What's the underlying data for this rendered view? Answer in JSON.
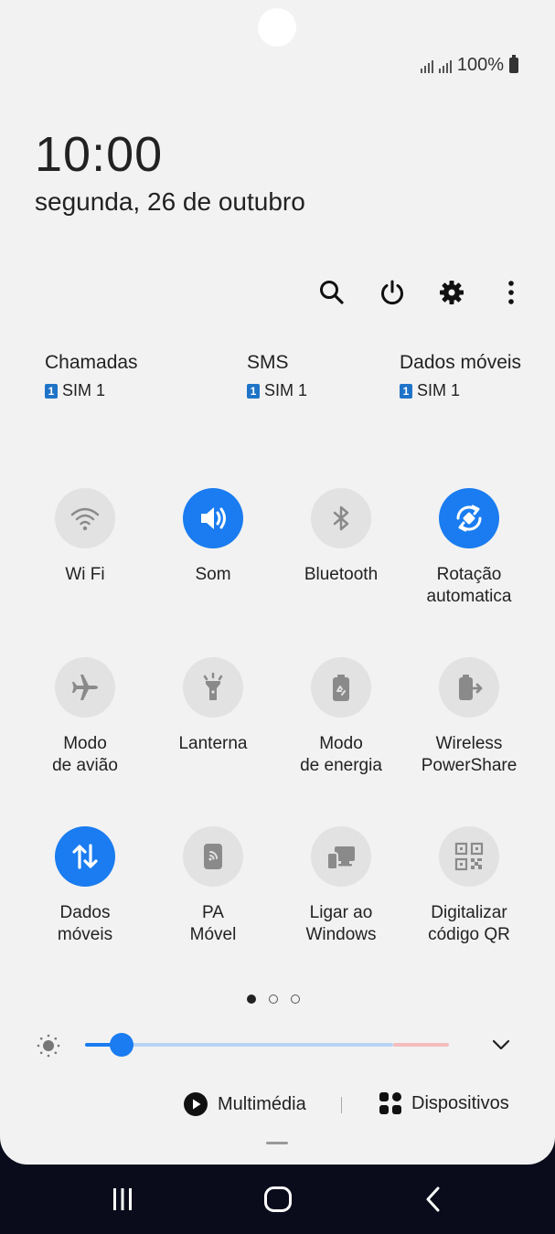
{
  "status_bar": {
    "battery_text": "100%"
  },
  "clock": {
    "time": "10:00",
    "date": "segunda, 26 de outubro"
  },
  "toolbar": {
    "icons": [
      "search-icon",
      "power-icon",
      "gear-icon",
      "more-vert-icon"
    ]
  },
  "sim_settings": [
    {
      "title": "Chamadas",
      "badge": "1",
      "sim": "SIM 1"
    },
    {
      "title": "SMS",
      "badge": "1",
      "sim": "SIM 1"
    },
    {
      "title": "Dados móveis",
      "badge": "1",
      "sim": "SIM 1"
    }
  ],
  "tiles": [
    {
      "label": "Wi Fi",
      "icon": "wifi-icon",
      "active": false
    },
    {
      "label": "Som",
      "icon": "volume-icon",
      "active": true
    },
    {
      "label": "Bluetooth",
      "icon": "bluetooth-icon",
      "active": false
    },
    {
      "label": "Rotação\nautomatica",
      "icon": "rotate-icon",
      "active": true
    },
    {
      "label": "Modo\nde avião",
      "icon": "airplane-icon",
      "active": false
    },
    {
      "label": "Lanterna",
      "icon": "flashlight-icon",
      "active": false
    },
    {
      "label": "Modo\nde energia",
      "icon": "battery-saver-icon",
      "active": false
    },
    {
      "label": "Wireless\nPowerShare",
      "icon": "powershare-icon",
      "active": false
    },
    {
      "label": "Dados\nmóveis",
      "icon": "data-arrows-icon",
      "active": true
    },
    {
      "label": "PA\nMóvel",
      "icon": "hotspot-icon",
      "active": false
    },
    {
      "label": "Ligar ao\nWindows",
      "icon": "link-windows-icon",
      "active": false
    },
    {
      "label": "Digitalizar\ncódigo QR",
      "icon": "qr-code-icon",
      "active": false
    }
  ],
  "pager": {
    "count": 3,
    "active_index": 0
  },
  "brightness": {
    "level": 0.1
  },
  "media": {
    "multimedia_label": "Multimédia",
    "devices_label": "Dispositivos"
  },
  "colors": {
    "accent": "#1a7cf0",
    "tile_off": "#e2e2e2",
    "panel_bg": "#f2f2f2",
    "nav_bg": "#0a0c1c"
  },
  "nav_bar": {
    "icons": [
      "recents-icon",
      "home-icon",
      "back-icon"
    ]
  }
}
